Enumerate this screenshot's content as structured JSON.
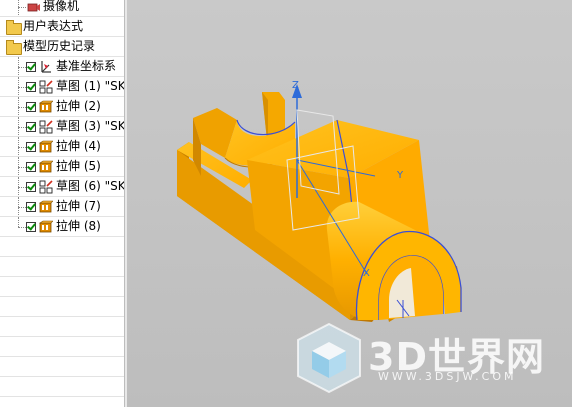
{
  "navigator": {
    "items": [
      {
        "label": "摄像机",
        "icon": "camera-icon",
        "indent": 1,
        "checkbox": false
      },
      {
        "label": "用户表达式",
        "icon": "folder-icon",
        "indent": 0,
        "checkbox": false
      },
      {
        "label": "模型历史记录",
        "icon": "folder-open-icon",
        "indent": 0,
        "checkbox": false
      },
      {
        "label": "基准坐标系",
        "icon": "datum-csys-icon",
        "indent": 1,
        "checkbox": true
      },
      {
        "label": "草图 (1) \"SK",
        "icon": "sketch-icon",
        "indent": 1,
        "checkbox": true
      },
      {
        "label": "拉伸 (2)",
        "icon": "extrude-icon",
        "indent": 1,
        "checkbox": true
      },
      {
        "label": "草图 (3) \"SK",
        "icon": "sketch-icon",
        "indent": 1,
        "checkbox": true
      },
      {
        "label": "拉伸 (4)",
        "icon": "extrude-icon",
        "indent": 1,
        "checkbox": true
      },
      {
        "label": "拉伸 (5)",
        "icon": "extrude-icon",
        "indent": 1,
        "checkbox": true
      },
      {
        "label": "草图 (6) \"SK",
        "icon": "sketch-icon",
        "indent": 1,
        "checkbox": true
      },
      {
        "label": "拉伸 (7)",
        "icon": "extrude-icon",
        "indent": 1,
        "checkbox": true
      },
      {
        "label": "拉伸 (8)",
        "icon": "extrude-icon",
        "indent": 1,
        "checkbox": true
      }
    ]
  },
  "viewport": {
    "axes": {
      "x": "X",
      "y": "Y",
      "z": "Z"
    },
    "watermark": {
      "text": "3D世界网",
      "url": "WWW.3DSJW.COM"
    }
  },
  "colors": {
    "model_top": "#ffb70a",
    "model_side": "#f0a000",
    "model_dark": "#d38a00",
    "edge_blue": "#3a4fd6",
    "csys_blue": "#2d6bd9"
  }
}
